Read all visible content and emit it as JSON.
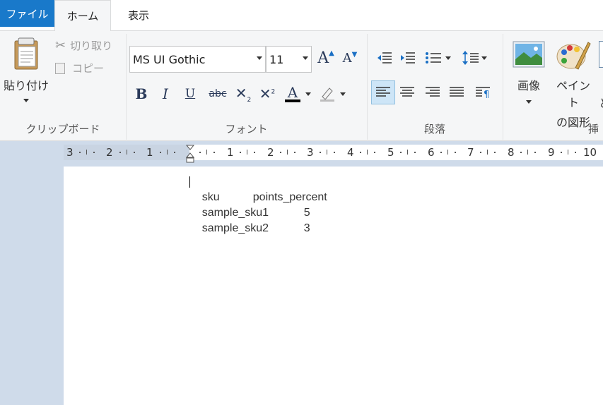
{
  "tabs": {
    "file": "ファイル",
    "home": "ホーム",
    "view": "表示"
  },
  "clipboard": {
    "paste": "貼り付け",
    "cut": "切り取り",
    "copy": "コピー",
    "group_label": "クリップボード"
  },
  "font": {
    "family": "MS UI Gothic",
    "size": "11",
    "group_label": "フォント",
    "bold": "B",
    "italic": "I",
    "underline": "U",
    "strike": "abc",
    "font_color_letter": "A"
  },
  "paragraph": {
    "group_label": "段落"
  },
  "insert": {
    "image": "画像",
    "paint_line1": "ペイント",
    "paint_line2": "の図形",
    "group_label_partial": "挿",
    "partial_char": "と"
  },
  "ruler": {
    "numbers": [
      "3",
      "2",
      "1",
      "1",
      "2",
      "3",
      "4",
      "5",
      "6",
      "7",
      "8",
      "9",
      "10"
    ]
  },
  "document": {
    "lines": [
      {
        "col1": "sku",
        "col2": "points_percent"
      },
      {
        "col1": "sample_sku1",
        "col2": "5"
      },
      {
        "col1": "sample_sku2",
        "col2": "3"
      }
    ]
  },
  "colors": {
    "file_tab": "#1979ca",
    "ribbon_bg": "#f5f6f7",
    "workspace_bg": "#cfdbea",
    "font_color_bar": "#000000"
  }
}
